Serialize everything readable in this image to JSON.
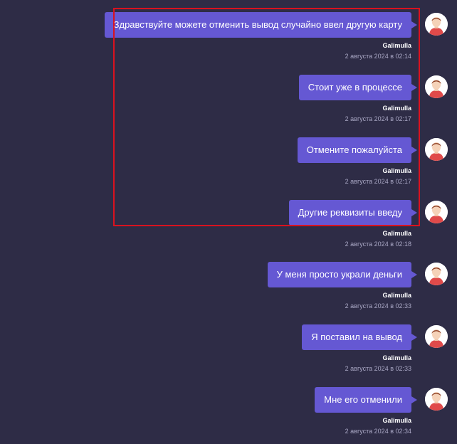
{
  "messages": [
    {
      "text": "Здравствуйте можете отменить вывод случайно ввел другую карту",
      "author": "Galimulla",
      "time": "2 августа 2024 в 02:14"
    },
    {
      "text": "Стоит уже в процессе",
      "author": "Galimulla",
      "time": "2 августа 2024 в 02:17"
    },
    {
      "text": "Отмените пожалуйста",
      "author": "Galimulla",
      "time": "2 августа 2024 в 02:17"
    },
    {
      "text": "Другие реквизиты введу",
      "author": "Galimulla",
      "time": "2 августа 2024 в 02:18"
    },
    {
      "text": "У меня просто украли деньги",
      "author": "Galimulla",
      "time": "2 августа 2024 в 02:33"
    },
    {
      "text": "Я поставил на вывод",
      "author": "Galimulla",
      "time": "2 августа 2024 в 02:33"
    },
    {
      "text": "Мне его отменили",
      "author": "Galimulla",
      "time": "2 августа 2024 в 02:34"
    }
  ],
  "avatar_icon": "user-avatar-icon",
  "colors": {
    "background": "#2e2c46",
    "bubble": "#6558d3",
    "highlight": "#d9121f",
    "timestamp": "#a9a7c4"
  }
}
